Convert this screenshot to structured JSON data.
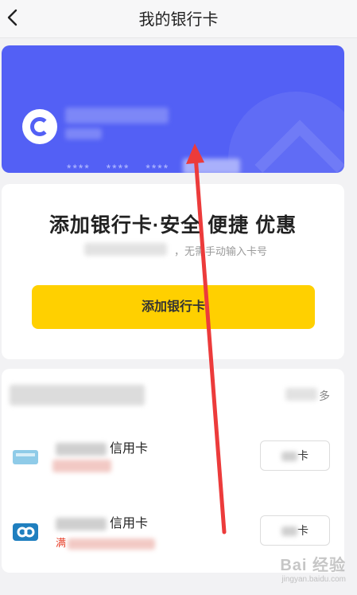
{
  "header": {
    "title": "我的银行卡",
    "back_icon": "chevron-left-icon"
  },
  "bank_card": {
    "card_number_masked": [
      "****",
      "****",
      "****"
    ],
    "card_color": "#5360f5"
  },
  "add_card": {
    "title": "添加银行卡·安全 便捷 优惠",
    "subtitle": "，无需手动输入卡号",
    "button_label": "添加银行卡",
    "button_color": "#ffd000"
  },
  "credit_cards": {
    "more_label": "多",
    "items": [
      {
        "name_suffix": "信用卡",
        "button_label": "卡",
        "icon": "bank-logo-icon"
      },
      {
        "name_suffix": "信用卡",
        "sub_prefix": "满",
        "button_label": "卡",
        "icon": "bank-logo-icon"
      }
    ]
  },
  "watermark": {
    "brand": "Bai 经验",
    "url": "jingyan.baidu.com"
  },
  "annotation": {
    "arrow_color": "#ec3b3b"
  }
}
